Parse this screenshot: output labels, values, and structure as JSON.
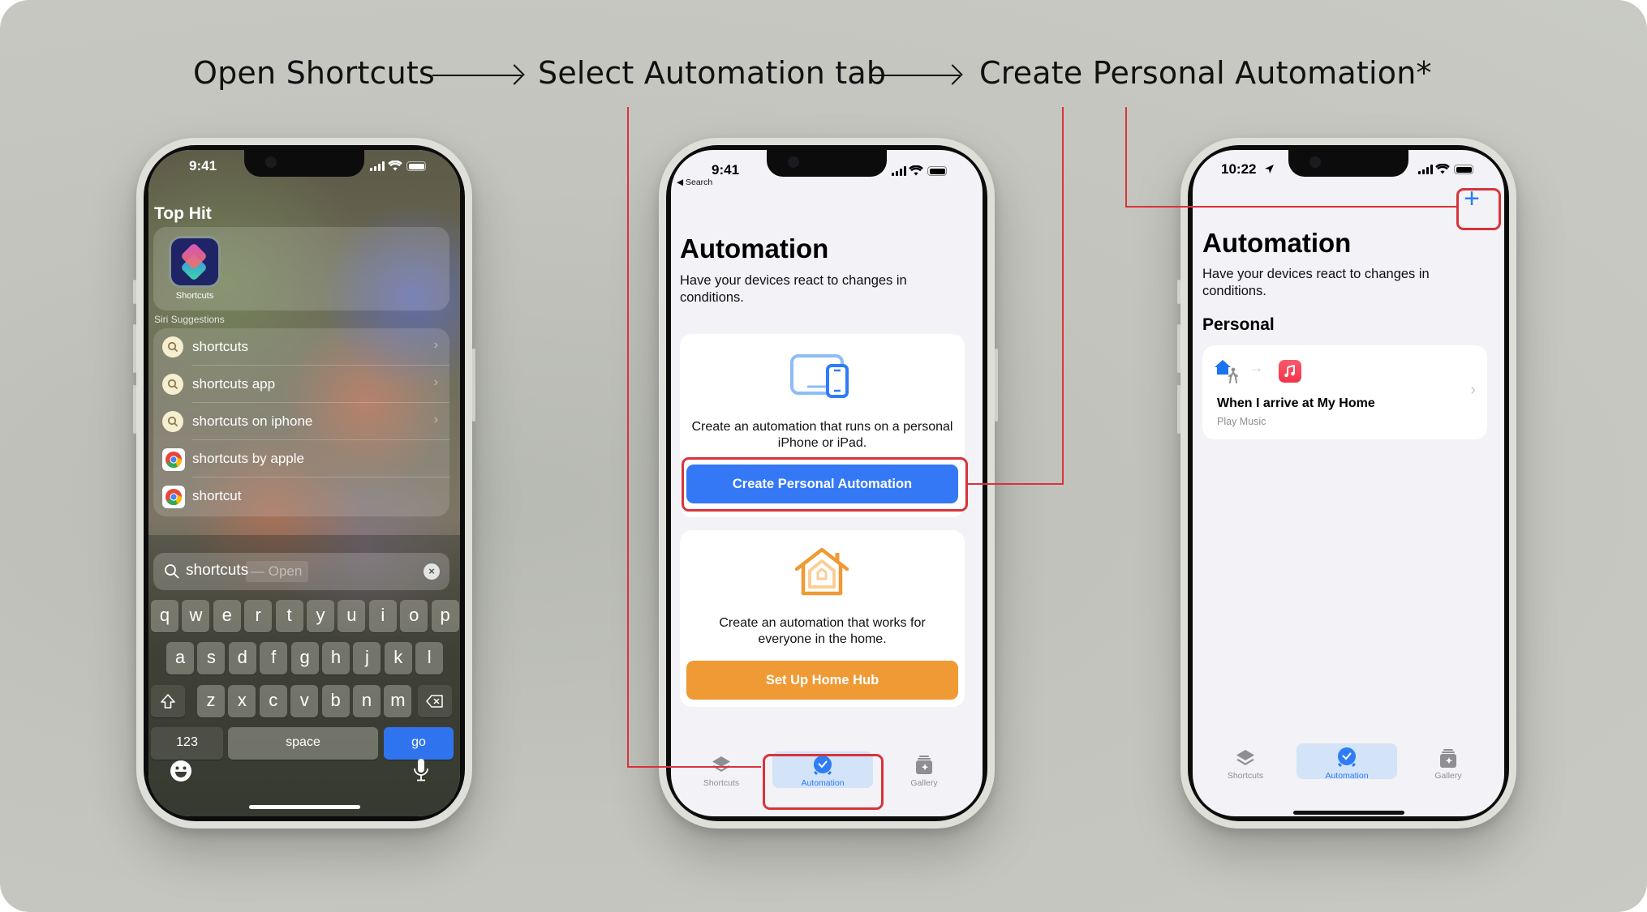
{
  "steps": [
    {
      "label": "Open Shortcuts"
    },
    {
      "label": "Select Automation tab"
    },
    {
      "label": "Create Personal Automation*"
    }
  ],
  "colors": {
    "callout_red": "#d8343a",
    "ios_blue": "#2e7cf6",
    "home_orange": "#f09a35"
  },
  "phone1": {
    "status_time": "9:41",
    "top_hit_heading": "Top Hit",
    "top_hit_app": {
      "label": "Shortcuts",
      "icon": "shortcuts-app-icon"
    },
    "siri_heading": "Siri Suggestions",
    "suggestions": [
      {
        "text": "shortcuts",
        "icon": "search-icon",
        "has_arrow": true
      },
      {
        "text": "shortcuts app",
        "icon": "search-icon",
        "has_arrow": true
      },
      {
        "text": "shortcuts on iphone",
        "icon": "search-icon",
        "has_arrow": true
      },
      {
        "text": "shortcuts by apple",
        "icon": "chrome-icon",
        "has_arrow": false
      },
      {
        "text": "shortcut",
        "icon": "chrome-icon",
        "has_arrow": false
      }
    ],
    "search": {
      "value": "shortcuts",
      "suffix": "— Open"
    },
    "keyboard": {
      "row1": [
        "q",
        "w",
        "e",
        "r",
        "t",
        "y",
        "u",
        "i",
        "o",
        "p"
      ],
      "row2": [
        "a",
        "s",
        "d",
        "f",
        "g",
        "h",
        "j",
        "k",
        "l"
      ],
      "row3": [
        "z",
        "x",
        "c",
        "v",
        "b",
        "n",
        "m"
      ],
      "numbers_key": "123",
      "space_key": "space",
      "go_key": "go"
    }
  },
  "phone2": {
    "status_time": "9:41",
    "back_label": "◀ Search",
    "title": "Automation",
    "subtitle": "Have your devices react to changes in conditions.",
    "personal_card": {
      "text": "Create an automation that runs on a personal iPhone or iPad.",
      "button": "Create Personal Automation"
    },
    "home_card": {
      "text": "Create an automation that works for everyone in the home.",
      "button": "Set Up Home Hub"
    },
    "tabs": [
      {
        "label": "Shortcuts",
        "active": false
      },
      {
        "label": "Automation",
        "active": true
      },
      {
        "label": "Gallery",
        "active": false
      }
    ]
  },
  "phone3": {
    "status_time": "10:22",
    "add_button": "+",
    "title": "Automation",
    "subtitle": "Have your devices react to changes in conditions.",
    "section": "Personal",
    "automation": {
      "title": "When I arrive at My Home",
      "action": "Play Music"
    },
    "tabs": [
      {
        "label": "Shortcuts",
        "active": false
      },
      {
        "label": "Automation",
        "active": true
      },
      {
        "label": "Gallery",
        "active": false
      }
    ]
  }
}
